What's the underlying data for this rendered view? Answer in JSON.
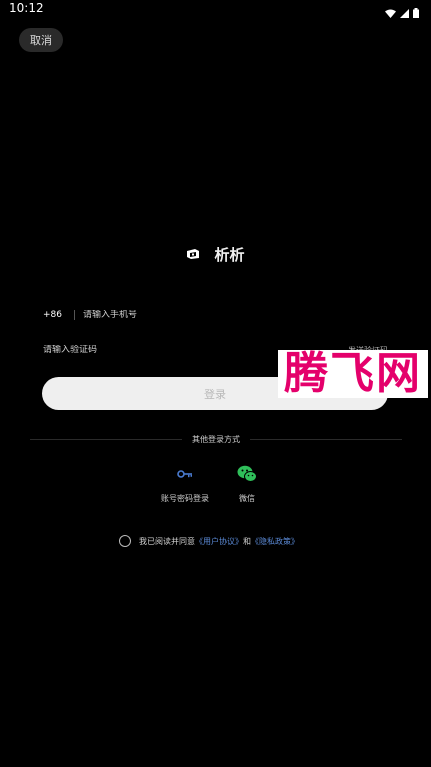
{
  "status_bar": {
    "time": "10:12"
  },
  "header": {
    "cancel_label": "取消"
  },
  "brand": {
    "app_name": "析析",
    "logo_icon": "app-logo-icon"
  },
  "form": {
    "country_code": "+86",
    "phone_placeholder": "请输入手机号",
    "code_placeholder": "请输入验证码",
    "send_code_label": "发送验证码",
    "login_label": "登录"
  },
  "other_login": {
    "title": "其他登录方式",
    "options": [
      {
        "label": "账号密码登录",
        "icon": "key-icon",
        "color": "#4a7bd0"
      },
      {
        "label": "微信",
        "icon": "wechat-icon",
        "color": "#2fbf5a"
      }
    ]
  },
  "agreement": {
    "prefix": "我已阅读并同意",
    "user_agreement": "《用户协议》",
    "conjunction": "和",
    "privacy_policy": "《隐私政策》",
    "link_color": "#5b8ad6"
  },
  "watermark": {
    "text": "腾飞网",
    "color": "#e4006b"
  }
}
